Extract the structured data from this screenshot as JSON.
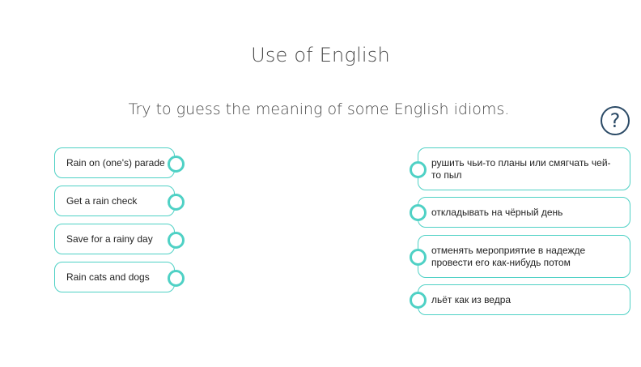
{
  "title": "Use of English",
  "subtitle": "Try to guess the meaning of some English idioms.",
  "help_symbol": "?",
  "idioms": [
    {
      "label": "Rain on (one's) parade"
    },
    {
      "label": "Get a rain check"
    },
    {
      "label": "Save for a rainy day"
    },
    {
      "label": "Rain cats and dogs"
    }
  ],
  "meanings": [
    {
      "label": "рушить чьи-то планы или смягчать чей-то пыл"
    },
    {
      "label": "откладывать на чёрный день"
    },
    {
      "label": "отменять мероприятие в надежде провести его как-нибудь потом"
    },
    {
      "label": "льёт как из ведра"
    }
  ],
  "colors": {
    "accent": "#4fd1c5",
    "help_icon": "#2b4a66",
    "heading_text": "#4a4a4a"
  }
}
